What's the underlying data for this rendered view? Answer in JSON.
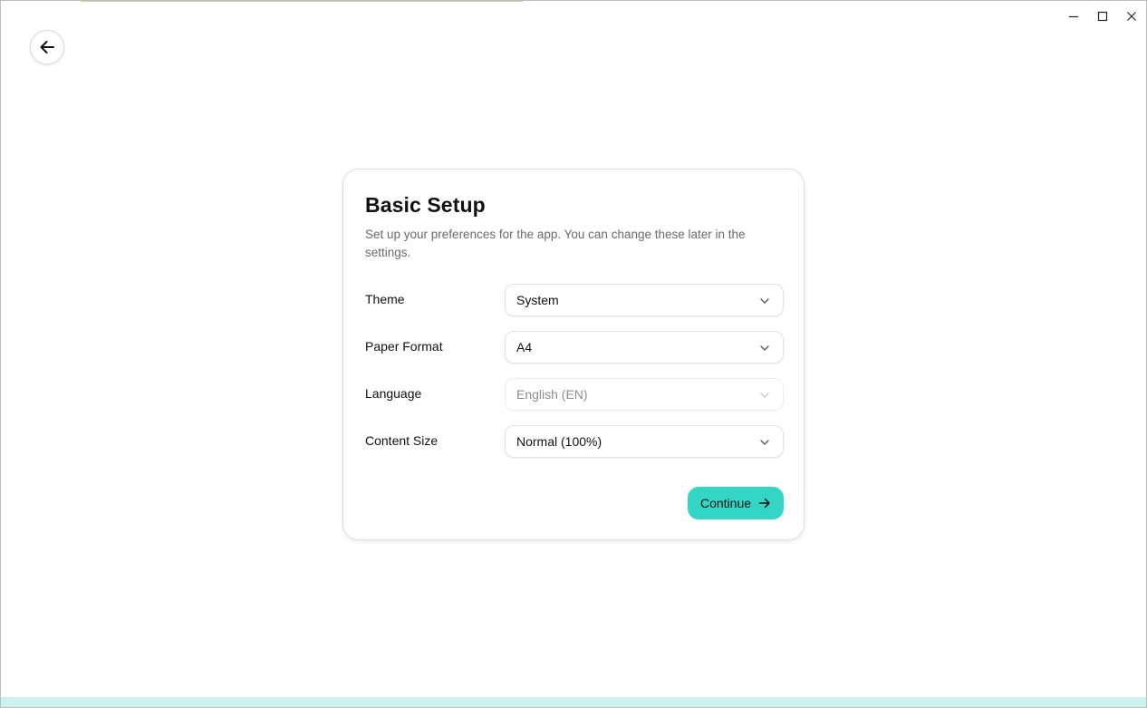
{
  "window": {
    "controls": [
      "minimize",
      "maximize",
      "close"
    ]
  },
  "nav": {
    "back_icon": "arrow-left-icon"
  },
  "setup": {
    "title": "Basic Setup",
    "description": "Set up your preferences for the app. You can change these later in the settings.",
    "fields": [
      {
        "label": "Theme",
        "value": "System",
        "disabled": false
      },
      {
        "label": "Paper Format",
        "value": "A4",
        "disabled": false
      },
      {
        "label": "Language",
        "value": "English (EN)",
        "disabled": true
      },
      {
        "label": "Content Size",
        "value": "Normal (100%)",
        "disabled": false
      }
    ],
    "continue_label": "Continue",
    "continue_icon": "arrow-right-icon"
  },
  "colors": {
    "accent": "#33d6c5",
    "bottom_bar": "#ccf2ee",
    "text": "#111111",
    "muted": "#6b6b6b"
  }
}
